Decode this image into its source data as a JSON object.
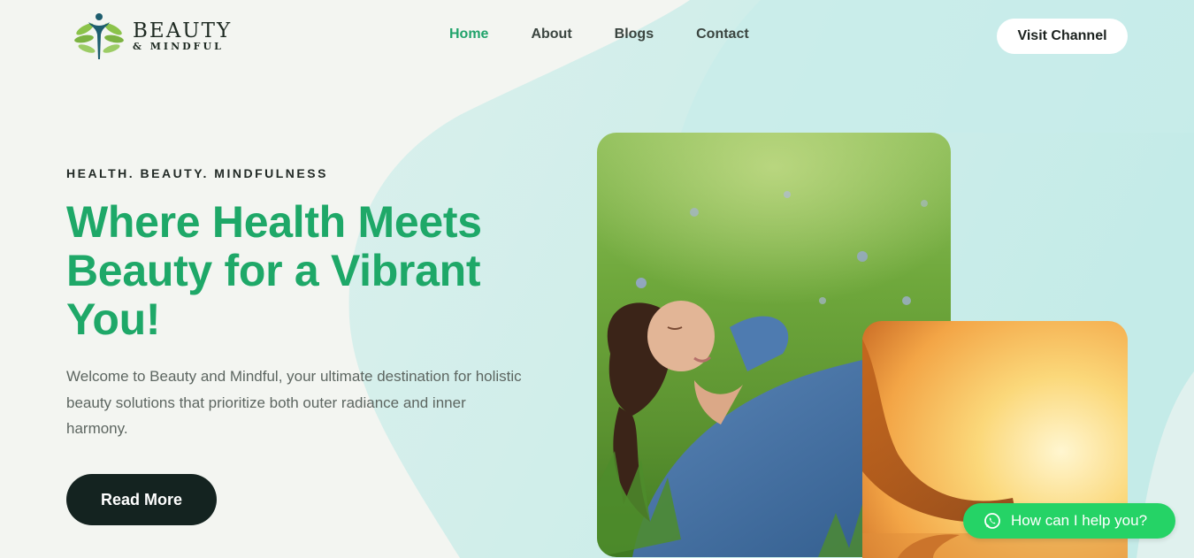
{
  "brand": {
    "name_primary": "BEAUTY",
    "name_secondary": "& MINDFUL",
    "logo_icon": "leaf-figure-logo"
  },
  "nav": {
    "items": [
      {
        "label": "Home",
        "active": true
      },
      {
        "label": "About",
        "active": false
      },
      {
        "label": "Blogs",
        "active": false
      },
      {
        "label": "Contact",
        "active": false
      }
    ],
    "cta_label": "Visit Channel"
  },
  "hero": {
    "eyebrow": "HEALTH. BEAUTY. MINDFULNESS",
    "headline": "Where Health Meets Beauty for a Vibrant You!",
    "description": "Welcome to Beauty and Mindful, your ultimate destination for holistic beauty solutions that prioritize both outer radiance and inner harmony.",
    "button_label": "Read More"
  },
  "images": {
    "main": "woman-relaxing-in-grass-photo",
    "secondary": "sunset-meditation-photo"
  },
  "chat": {
    "icon": "whatsapp-icon",
    "label": "How can I help you?"
  },
  "colors": {
    "accent": "#21a36b",
    "headline": "#1ea868",
    "background": "#f3f5f1",
    "blob": "#c7ede9",
    "dark_button": "#142320",
    "chat": "#25d366"
  }
}
